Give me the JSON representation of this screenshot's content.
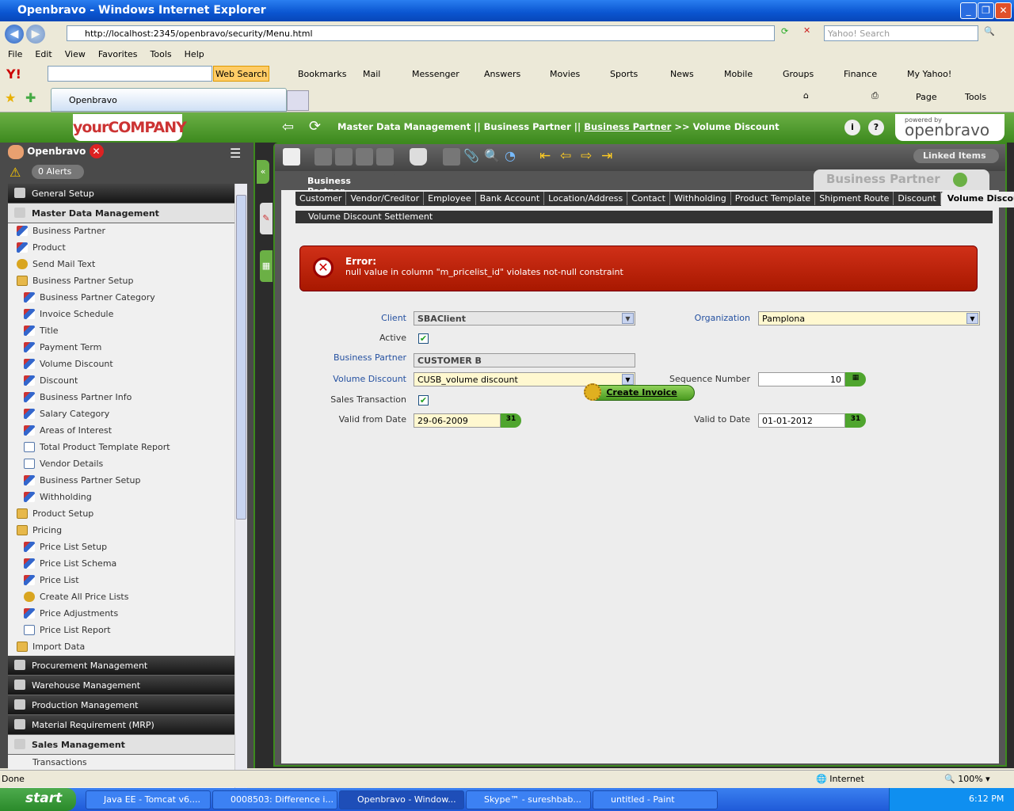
{
  "browser": {
    "title": "Openbravo - Windows Internet Explorer",
    "url": "http://localhost:2345/openbravo/security/Menu.html",
    "search_placeholder": "Yahoo! Search",
    "menu": [
      "File",
      "Edit",
      "View",
      "Favorites",
      "Tools",
      "Help"
    ],
    "yahoo_toolbar": {
      "web_search": "Web Search",
      "items": [
        "Bookmarks",
        "Mail",
        "Messenger",
        "Answers",
        "Movies",
        "Sports",
        "News",
        "Mobile",
        "Groups",
        "Finance",
        "My Yahoo!"
      ]
    },
    "tab": "Openbravo",
    "cmd": {
      "page": "Page",
      "tools": "Tools"
    },
    "status": {
      "left": "Done",
      "zone": "Internet",
      "zoom": "100%"
    }
  },
  "app": {
    "logo": "yourCOMPANY",
    "user": "Openbravo",
    "alerts": "0 Alerts",
    "breadcrumb": {
      "part1": "Master Data Management || Business Partner ||",
      "link": "Business Partner",
      "part2": ">> Volume Discount"
    },
    "powered": "powered by",
    "brand": "openbravo",
    "linked_items": "Linked Items",
    "sidebar": {
      "top": [
        {
          "label": "General Setup"
        },
        {
          "label": "Master Data Management"
        }
      ],
      "items": [
        {
          "label": "Business Partner",
          "type": "win",
          "level": 1
        },
        {
          "label": "Product",
          "type": "win",
          "level": 1
        },
        {
          "label": "Send Mail Text",
          "type": "proc",
          "level": 1
        },
        {
          "label": "Business Partner Setup",
          "type": "fold",
          "level": 1
        },
        {
          "label": "Business Partner Category",
          "type": "win",
          "level": 2
        },
        {
          "label": "Invoice Schedule",
          "type": "win",
          "level": 2
        },
        {
          "label": "Title",
          "type": "win",
          "level": 2
        },
        {
          "label": "Payment Term",
          "type": "win",
          "level": 2
        },
        {
          "label": "Volume Discount",
          "type": "win",
          "level": 2
        },
        {
          "label": "Discount",
          "type": "win",
          "level": 2
        },
        {
          "label": "Business Partner Info",
          "type": "win",
          "level": 2
        },
        {
          "label": "Salary Category",
          "type": "win",
          "level": 2
        },
        {
          "label": "Areas of Interest",
          "type": "win",
          "level": 2
        },
        {
          "label": "Total Product Template Report",
          "type": "rep",
          "level": 2
        },
        {
          "label": "Vendor Details",
          "type": "rep",
          "level": 2
        },
        {
          "label": "Business Partner Setup",
          "type": "win",
          "level": 2
        },
        {
          "label": "Withholding",
          "type": "win",
          "level": 2
        },
        {
          "label": "Product Setup",
          "type": "fold",
          "level": 1
        },
        {
          "label": "Pricing",
          "type": "fold",
          "level": 1
        },
        {
          "label": "Price List Setup",
          "type": "win",
          "level": 2
        },
        {
          "label": "Price List Schema",
          "type": "win",
          "level": 2
        },
        {
          "label": "Price List",
          "type": "win",
          "level": 2
        },
        {
          "label": "Create All Price Lists",
          "type": "proc",
          "level": 2
        },
        {
          "label": "Price Adjustments",
          "type": "win",
          "level": 2
        },
        {
          "label": "Price List Report",
          "type": "rep",
          "level": 2
        },
        {
          "label": "Import Data",
          "type": "fold",
          "level": 1
        }
      ],
      "bottom": [
        {
          "label": "Procurement Management"
        },
        {
          "label": "Warehouse Management"
        },
        {
          "label": "Production Management"
        },
        {
          "label": "Material Requirement (MRP)"
        },
        {
          "label": "Sales Management"
        }
      ],
      "trailing": "Transactions"
    },
    "window": {
      "parent_tab": "Business Partner",
      "title": "Business Partner",
      "tabs": [
        "Customer",
        "Vendor/Creditor",
        "Employee",
        "Bank Account",
        "Location/Address",
        "Contact",
        "Withholding",
        "Product Template",
        "Shipment Route",
        "Discount",
        "Volume Discount"
      ],
      "active_tab": "Volume Discount",
      "subtab": "Volume Discount Settlement",
      "error": {
        "title": "Error:",
        "message": "null value in column \"m_pricelist_id\" violates not-null constraint"
      },
      "form": {
        "client_label": "Client",
        "client": "SBAClient",
        "org_label": "Organization",
        "org": "Pamplona",
        "active_label": "Active",
        "bp_label": "Business Partner",
        "bp": "CUSTOMER B",
        "vd_label": "Volume Discount",
        "vd": "CUSB_volume discount",
        "seq_label": "Sequence Number",
        "seq": "10",
        "sales_label": "Sales Transaction",
        "from_label": "Valid from Date",
        "from": "29-06-2009",
        "to_label": "Valid to Date",
        "to": "01-01-2012",
        "cal": "31",
        "create_invoice": "Create Invoice"
      }
    }
  },
  "taskbar": {
    "start": "start",
    "tasks": [
      "Java EE - Tomcat v6....",
      "0008503: Difference i...",
      "Openbravo - Window...",
      "Skype™ - sureshbab...",
      "untitled - Paint"
    ],
    "clock": "6:12 PM"
  }
}
